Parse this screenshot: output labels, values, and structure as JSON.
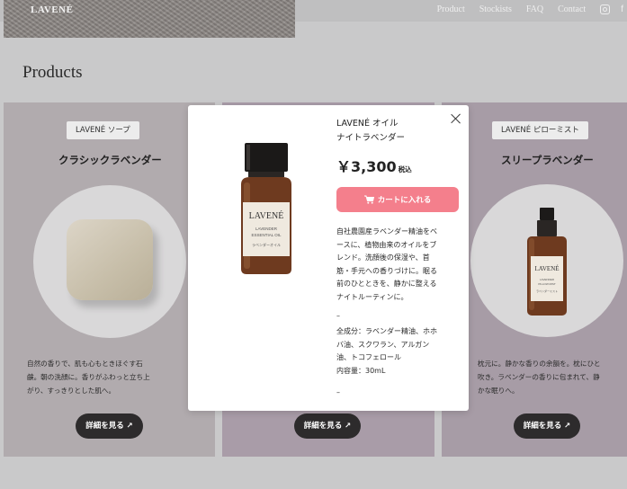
{
  "header": {
    "logo": "LAVENÉ",
    "nav": [
      "Product",
      "Stockists",
      "FAQ",
      "Contact"
    ],
    "social": {
      "instagram_icon": "instagram-icon",
      "facebook_label": "f"
    }
  },
  "page_title": "Products",
  "cards": [
    {
      "category": "LAVENÉ ソープ",
      "title": "クラシックラベンダー",
      "description_lines": [
        "自然の香りで、肌も心もときほぐす石",
        "鹸。朝の洗顔に。香りがふわっと立ち上",
        "がり、すっきりとした肌へ。"
      ],
      "button": "詳細を見る ↗"
    },
    {
      "category": "",
      "title": "",
      "description_lines": [],
      "button": "詳細を見る ↗"
    },
    {
      "category": "LAVENÉ ピローミスト",
      "title": "スリープラベンダー",
      "description_lines": [
        "枕元に。静かな香りの余韻を。枕にひと",
        "吹き。ラベンダーの香りに包まれて、静",
        "かな眠りへ。"
      ],
      "button": "詳細を見る ↗"
    }
  ],
  "modal": {
    "brand": "LAVENÉ オイル",
    "name": "ナイトラベンダー",
    "price": "￥3,300",
    "tax": "税込",
    "cart_button": "カートに入れる",
    "description_lines": [
      "自社農園産ラベンダー精油をベ",
      "ースに、植物由来のオイルをブ",
      "レンド。洗顔後の保湿や、首",
      "筋・手元への香りづけに。眠る",
      "前のひとときを、静かに整える",
      "ナイトルーティンに。"
    ],
    "dash": "–",
    "spec_lines": [
      "全成分：ラベンダー精油、ホホ",
      "バ油、スクワラン、アルガン",
      "油、トコフェロール",
      "内容量：30mL"
    ],
    "label_brand": "LAVENÉ",
    "label_line1": "LAVENDER",
    "label_line2": "ESSENTIAL OIL",
    "label_jp": "ラベンダーオイル",
    "mist_label_brand": "LAVENÉ",
    "mist_label_line1": "LAVENDER",
    "mist_label_line2": "PILLOW MIST",
    "mist_label_jp": "ラベンダーミスト"
  },
  "colors": {
    "accent_pink": "#f47f8c",
    "dark_button": "#2d2b2c",
    "card_1_bg": "#b1abae",
    "card_2_bg": "#a99ca8",
    "card_3_bg": "#a79ca6"
  }
}
